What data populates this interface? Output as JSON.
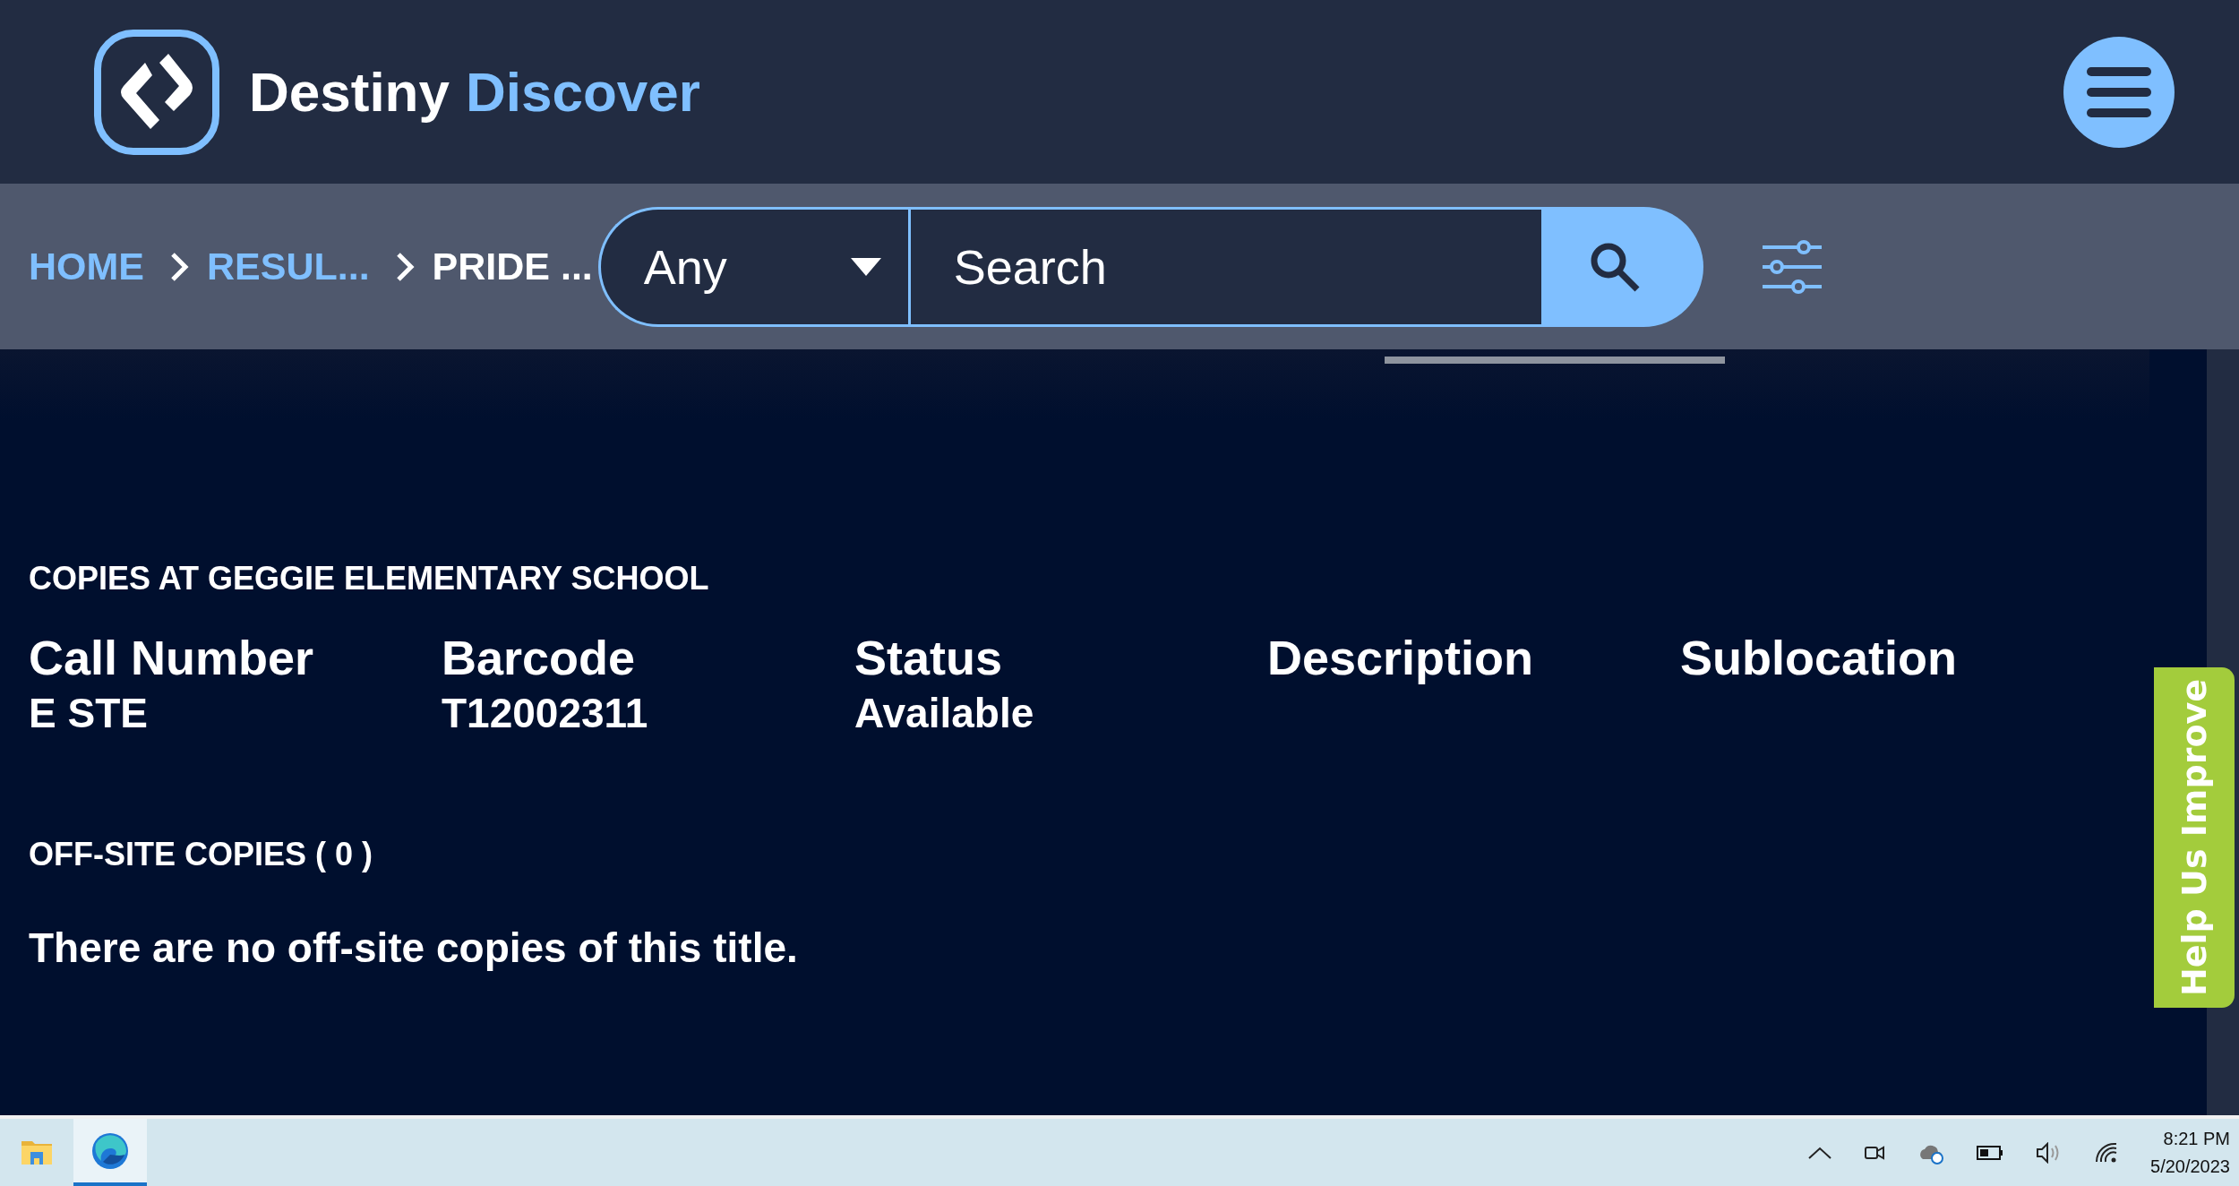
{
  "header": {
    "brand_first": "Destiny",
    "brand_second": "Discover"
  },
  "breadcrumbs": [
    {
      "label": "HOME",
      "kind": "link"
    },
    {
      "label": "RESUL...",
      "kind": "link"
    },
    {
      "label": "PRIDE ...",
      "kind": "current"
    }
  ],
  "search": {
    "scope": "Any",
    "placeholder": "Search"
  },
  "copies": {
    "title": "COPIES AT GEGGIE ELEMENTARY SCHOOL",
    "columns": [
      "Call Number",
      "Barcode",
      "Status",
      "Description",
      "Sublocation"
    ],
    "rows": [
      [
        "E STE",
        "T12002311",
        "Available",
        "",
        ""
      ]
    ]
  },
  "offsite": {
    "title": "OFF-SITE COPIES ( 0 )",
    "message": "There are no off-site copies of this title."
  },
  "feedback_tab": "Help Us Improve",
  "taskbar": {
    "apps": [
      {
        "kind": "folder",
        "selected": false
      },
      {
        "kind": "browser",
        "selected": true
      }
    ],
    "time": "8:21 PM",
    "date": "5/20/2023"
  }
}
